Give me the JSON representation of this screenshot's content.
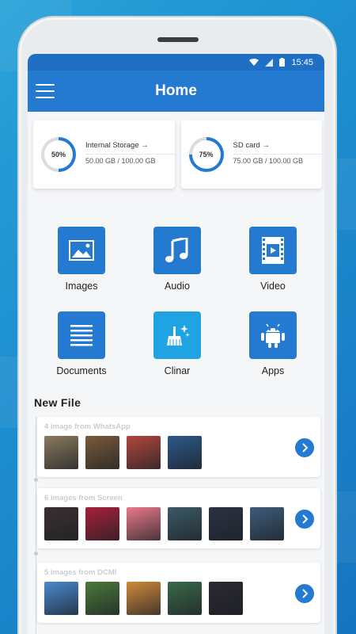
{
  "status_bar": {
    "time": "15:45"
  },
  "app_bar": {
    "title": "Home"
  },
  "storage": [
    {
      "name": "Internal Storage →",
      "percent_label": "50%",
      "percent": 50,
      "size": "50.00 GB / 100.00 GB"
    },
    {
      "name": "SD card →",
      "percent_label": "75%",
      "percent": 75,
      "size": "75.00 GB / 100.00 GB"
    }
  ],
  "categories": [
    {
      "label": "Images",
      "icon": "image-icon",
      "color": "#2479d1"
    },
    {
      "label": "Audio",
      "icon": "music-note-icon",
      "color": "#2479d1"
    },
    {
      "label": "Video",
      "icon": "film-icon",
      "color": "#2479d1"
    },
    {
      "label": "Documents",
      "icon": "document-lines-icon",
      "color": "#2479d1"
    },
    {
      "label": "Clinar",
      "icon": "broom-sparkle-icon",
      "color": "#1fa3e3"
    },
    {
      "label": "Apps",
      "icon": "android-icon",
      "color": "#2479d1"
    }
  ],
  "new_file": {
    "heading": "New File",
    "groups": [
      {
        "title": "4 image from WhatsApp",
        "thumb_colors": [
          "#8a7a5e",
          "#7a5a3a",
          "#b2473e",
          "#2d5a8a"
        ]
      },
      {
        "title": "6 images from Screen",
        "thumb_colors": [
          "#3a3030",
          "#a8203a",
          "#e87a8a",
          "#3c5a66",
          "#2a3244",
          "#3f5c7a"
        ]
      },
      {
        "title": "5 images from DCMI",
        "thumb_colors": [
          "#4a8ad0",
          "#4a7a3a",
          "#d08a3a",
          "#3a6a4a",
          "#2a2a30"
        ]
      }
    ]
  },
  "colors": {
    "primary": "#2479d1",
    "status_bar": "#1f6fc4",
    "clean_accent": "#1fa3e3"
  }
}
